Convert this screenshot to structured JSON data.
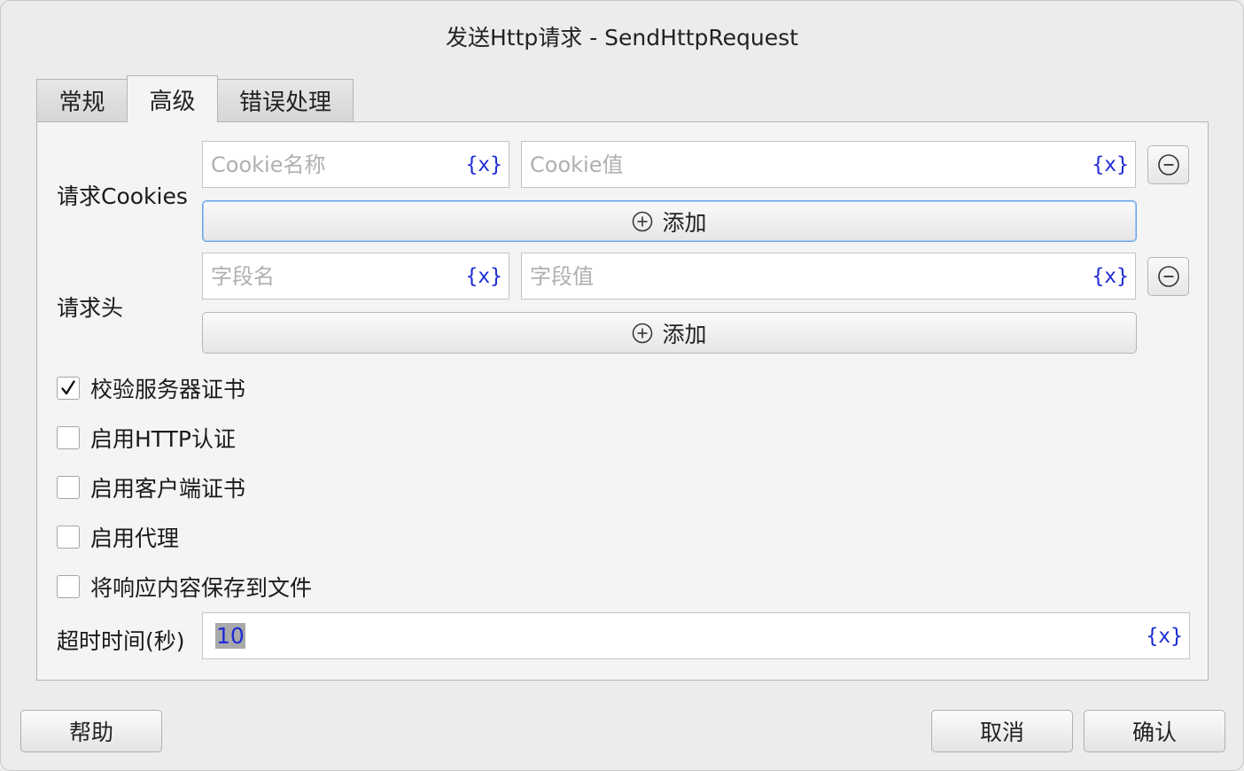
{
  "window": {
    "title": "发送Http请求 - SendHttpRequest"
  },
  "tabs": [
    {
      "label": "常规",
      "active": false
    },
    {
      "label": "高级",
      "active": true
    },
    {
      "label": "错误处理",
      "active": false
    }
  ],
  "cookies": {
    "label": "请求Cookies",
    "name_placeholder": "Cookie名称",
    "value_placeholder": "Cookie值",
    "var_label": "{x}",
    "add_label": "添加"
  },
  "headers": {
    "label": "请求头",
    "name_placeholder": "字段名",
    "value_placeholder": "字段值",
    "var_label": "{x}",
    "add_label": "添加"
  },
  "options": [
    {
      "label": "校验服务器证书",
      "checked": true
    },
    {
      "label": "启用HTTP认证",
      "checked": false
    },
    {
      "label": "启用客户端证书",
      "checked": false
    },
    {
      "label": "启用代理",
      "checked": false
    },
    {
      "label": "将响应内容保存到文件",
      "checked": false
    }
  ],
  "timeout": {
    "label": "超时时间(秒)",
    "value": "10",
    "var_label": "{x}"
  },
  "footer": {
    "help_label": "帮助",
    "cancel_label": "取消",
    "ok_label": "确认"
  },
  "colors": {
    "variable_blue": "#1d2bd6",
    "focus_border": "#6aa3e6"
  }
}
